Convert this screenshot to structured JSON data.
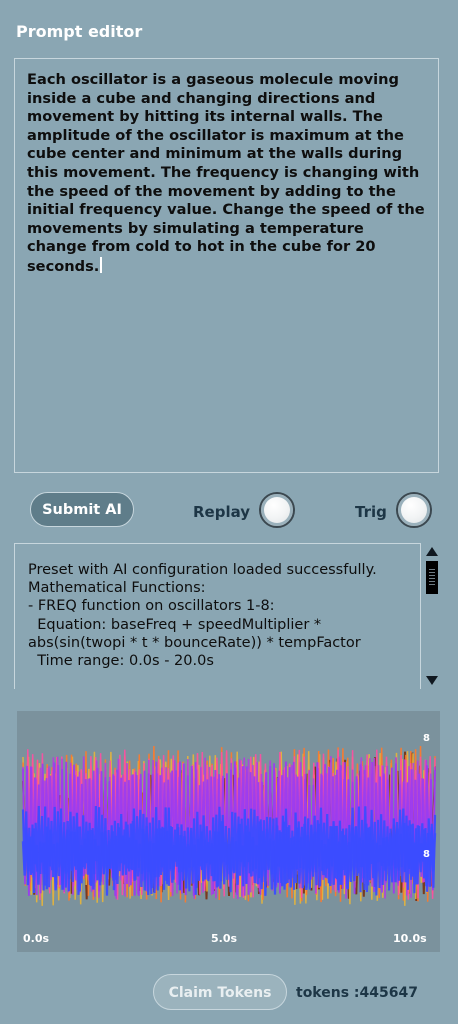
{
  "header": {
    "title": "Prompt editor"
  },
  "prompt": {
    "text": "Each oscillator is a gaseous molecule moving inside a cube and changing directions and movement by hitting its internal walls. The amplitude of the oscillator is maximum at the cube center and minimum at the walls during this movement. The frequency is changing with the speed of the movement by adding to the initial frequency value. Change the speed of the movements by simulating a temperature change from cold to hot in the cube for 20 seconds."
  },
  "controls": {
    "submit_label": "Submit AI",
    "replay_label": "Replay",
    "trig_label": "Trig"
  },
  "console": {
    "lines": [
      "Preset with AI configuration loaded successfully.",
      "",
      "Mathematical Functions:",
      "- FREQ function on oscillators 1-8:",
      "  Equation: baseFreq + speedMultiplier *",
      "abs(sin(twopi * t * bounceRate)) * tempFactor",
      "  Time range: 0.0s - 20.0s"
    ]
  },
  "chart_data": {
    "type": "line",
    "x_ticks": [
      "0.0s",
      "5.0s",
      "10.0s"
    ],
    "xlim": [
      0,
      10
    ],
    "series_labels": [
      "8",
      "8"
    ],
    "colors": {
      "brown": "#7a3a1e",
      "purple": "#9b3cf0",
      "blue": "#3b4dff",
      "orange": "#ff7a2a",
      "pink": "#ff4fa3",
      "yellow": "#e8b53a",
      "violet": "#b040e0"
    }
  },
  "footer": {
    "claim_label": "Claim Tokens",
    "tokens_text": "tokens :445647"
  }
}
